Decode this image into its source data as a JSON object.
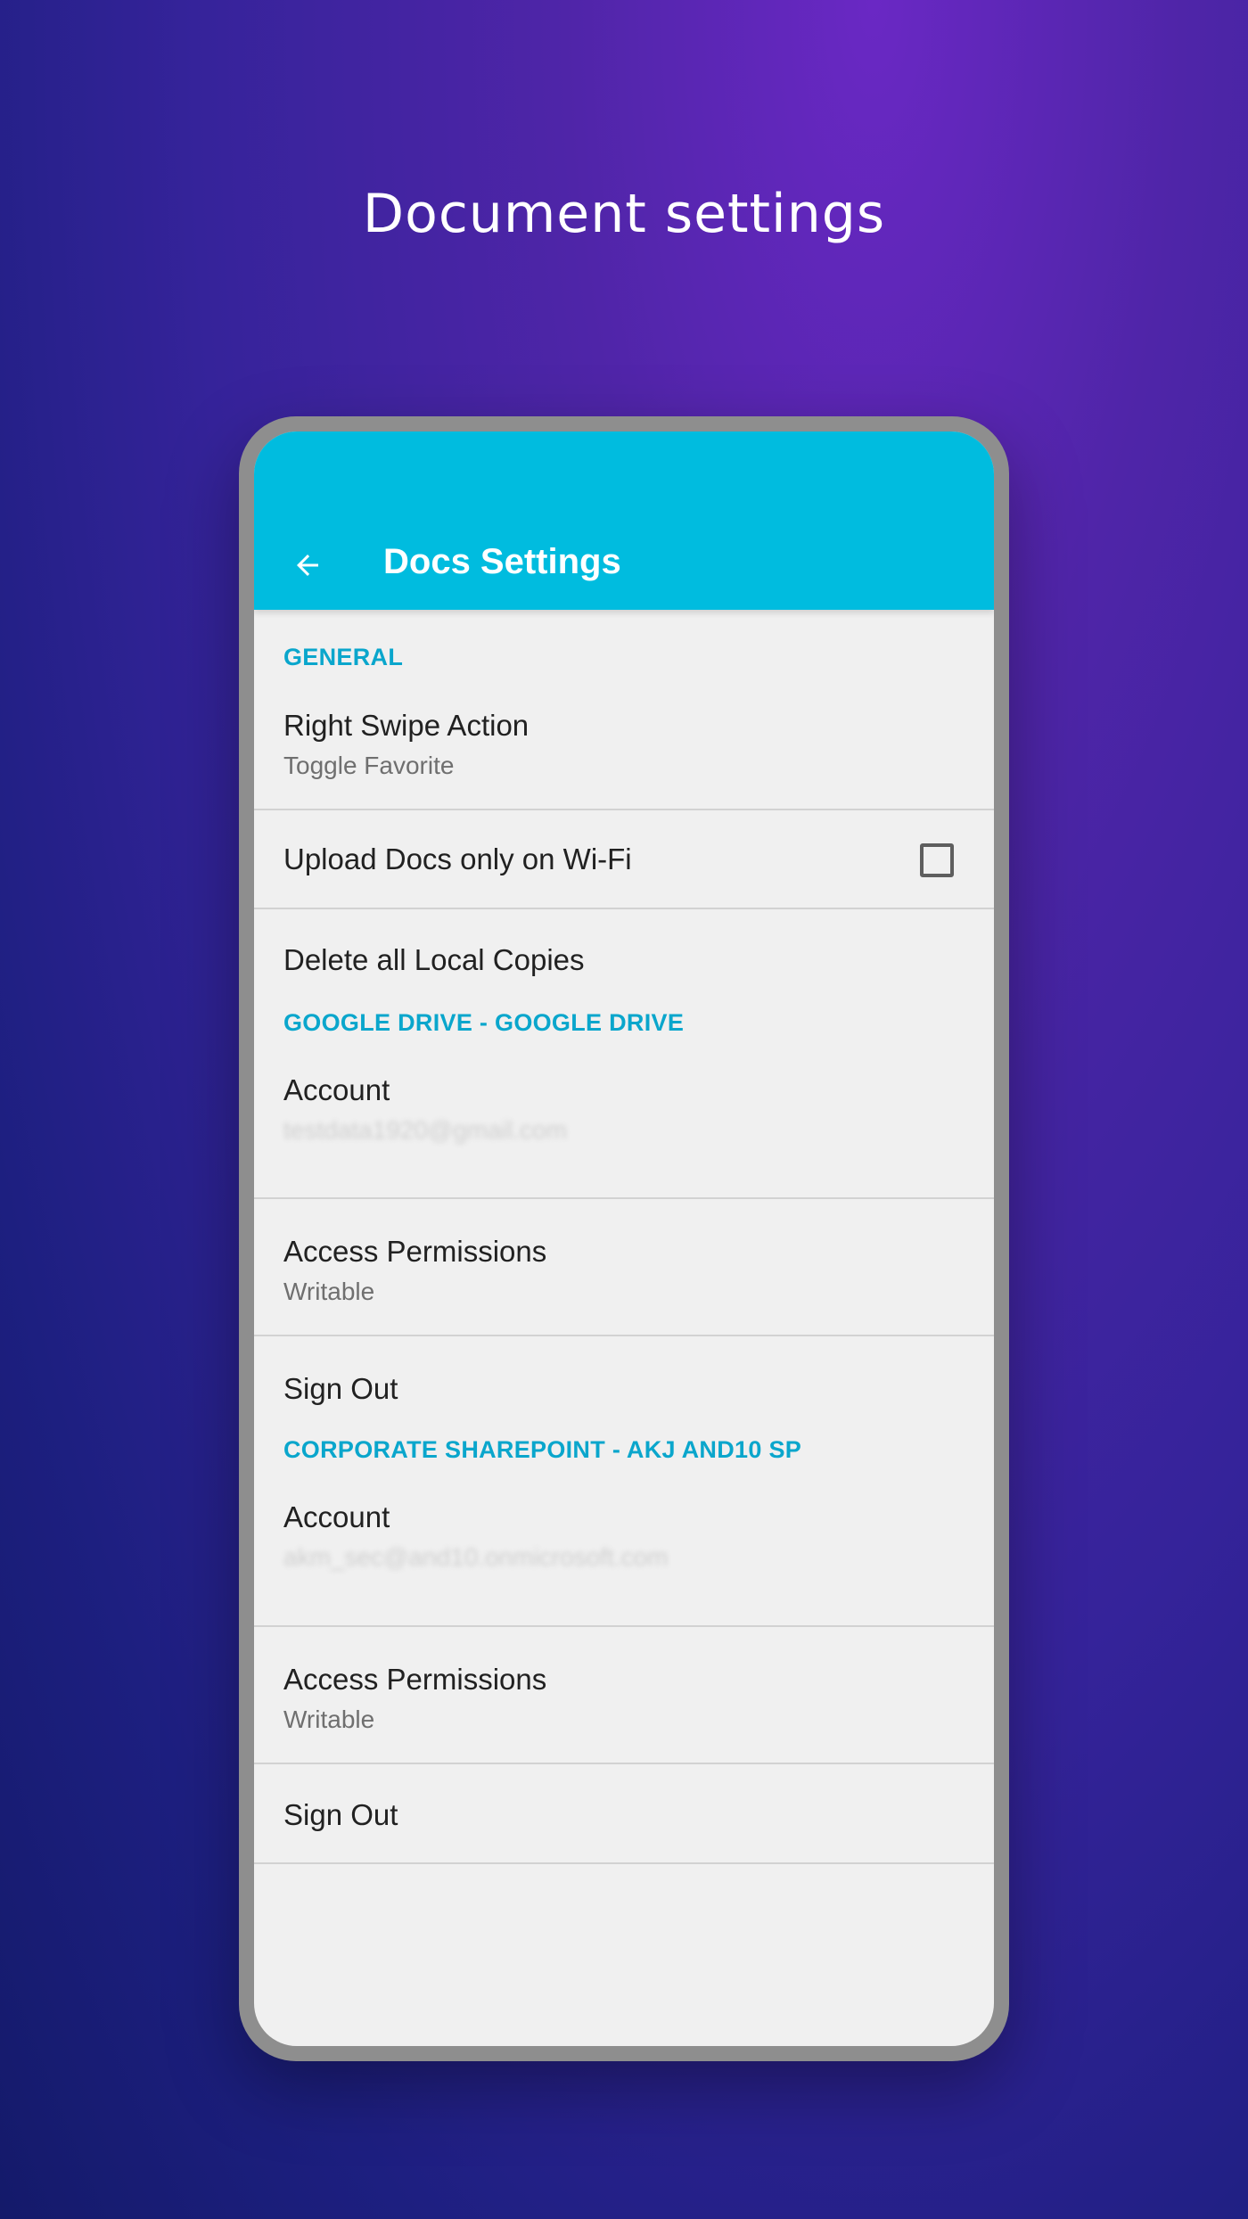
{
  "promo": {
    "headline": "Document settings"
  },
  "appbar": {
    "title": "Docs Settings",
    "back_icon": "arrow-left-icon"
  },
  "sections": {
    "general": {
      "header": "GENERAL",
      "right_swipe": {
        "title": "Right Swipe Action",
        "value": "Toggle Favorite"
      },
      "upload_wifi": {
        "title": "Upload Docs only on Wi-Fi",
        "checked": false
      },
      "delete_local": {
        "title": "Delete all Local Copies"
      }
    },
    "google_drive": {
      "header": "GOOGLE DRIVE - GOOGLE DRIVE",
      "account": {
        "title": "Account",
        "value": "testdata1920@gmail.com"
      },
      "access": {
        "title": "Access Permissions",
        "value": "Writable"
      },
      "sign_out": {
        "title": "Sign Out"
      }
    },
    "sharepoint": {
      "header": "CORPORATE SHAREPOINT - AKJ AND10 SP",
      "account": {
        "title": "Account",
        "value": "akm_sec@and10.onmicrosoft.com"
      },
      "access": {
        "title": "Access Permissions",
        "value": "Writable"
      },
      "sign_out": {
        "title": "Sign Out"
      }
    }
  },
  "colors": {
    "appbar": "#00bcdf",
    "section_header": "#0aa6cc",
    "screen_bg": "#f0f0f0"
  }
}
